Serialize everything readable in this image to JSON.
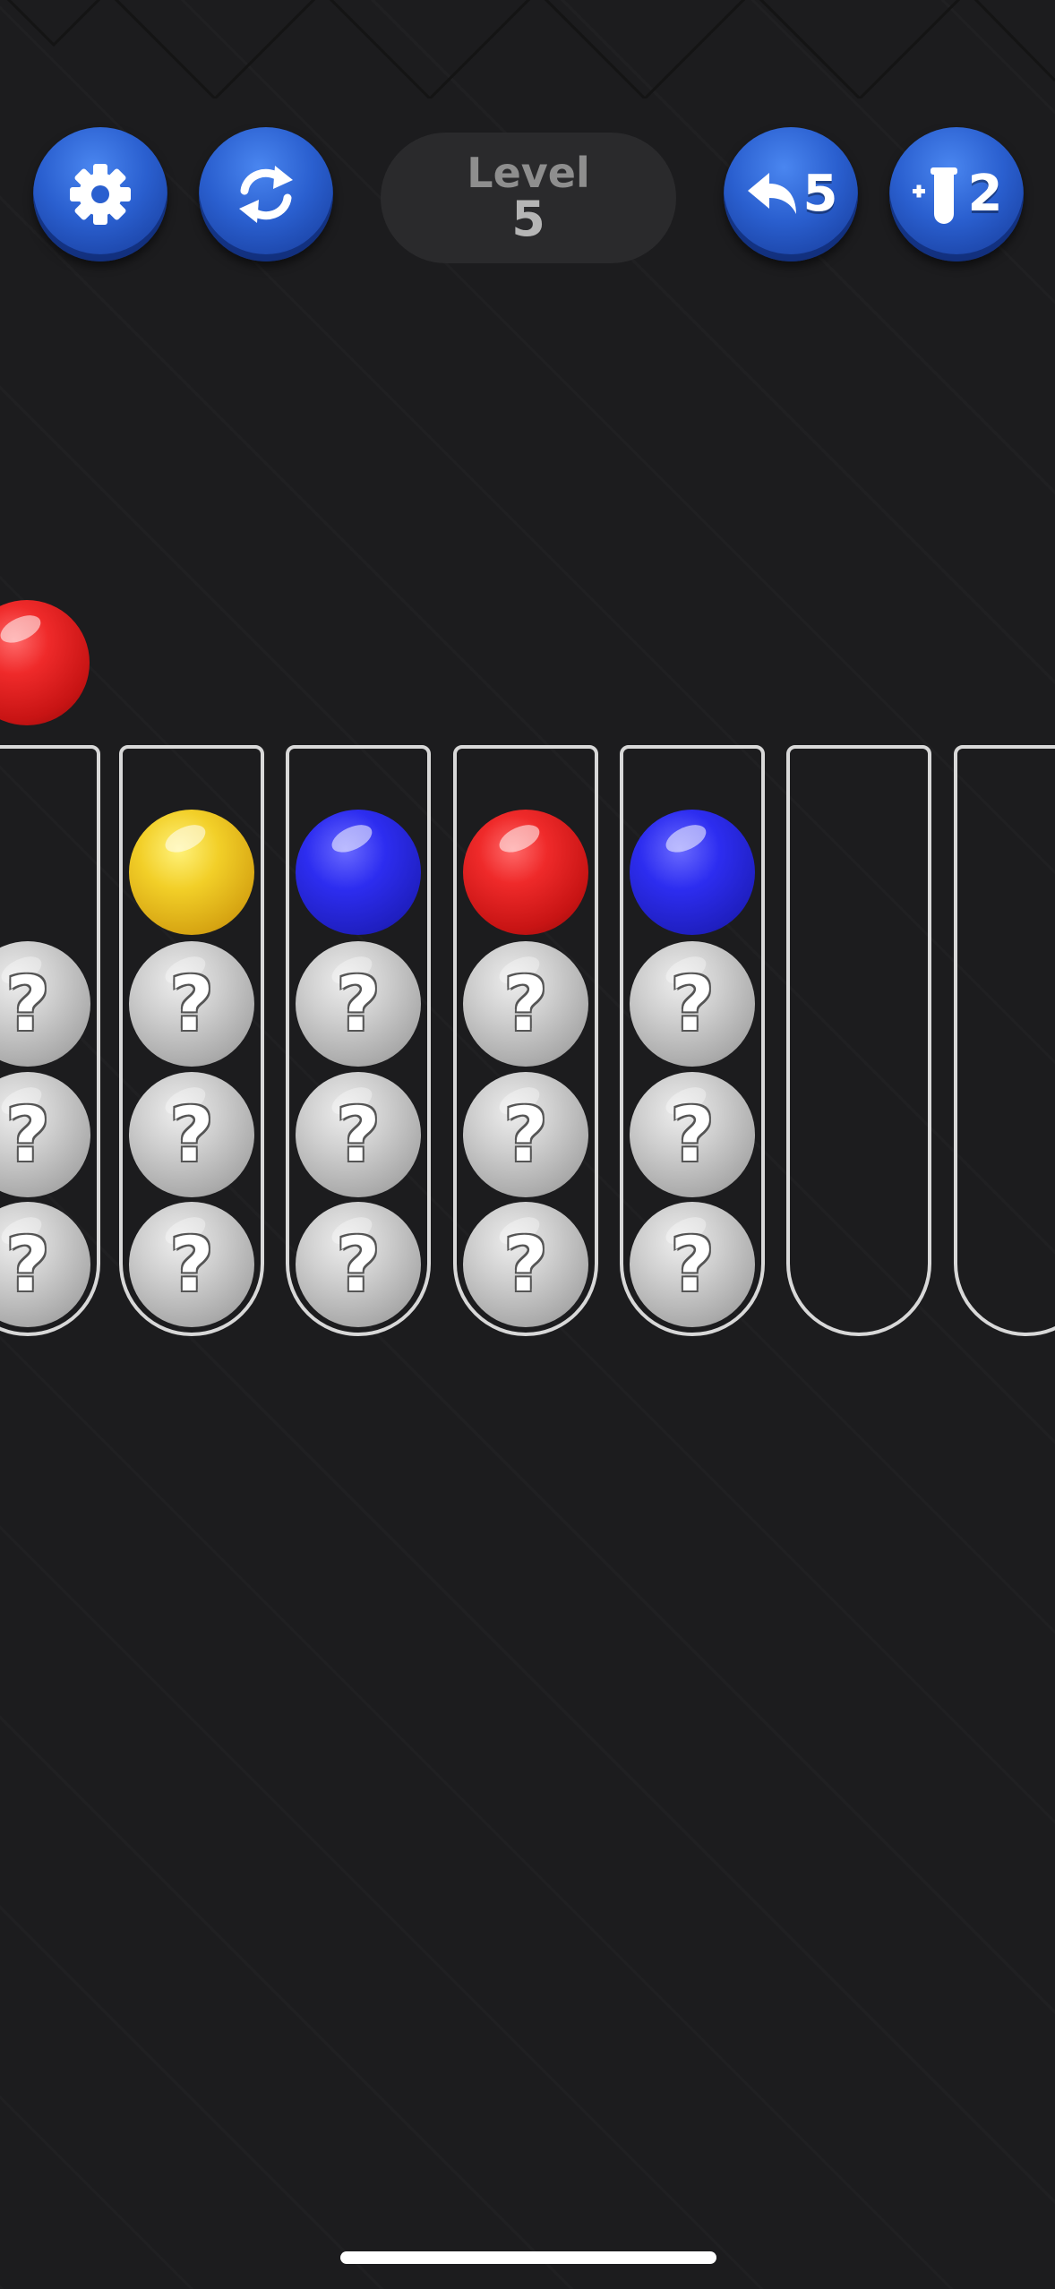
{
  "header": {
    "settings_icon": "gear-icon",
    "restart_icon": "restart-icon",
    "level_label": "Level",
    "level_number": "5",
    "undo_icon": "undo-arrow-icon",
    "undo_count": "5",
    "add_tube_icon": "add-tube-icon",
    "add_tube_count": "2"
  },
  "colors": {
    "background": "#1c1c1e",
    "button_blue": "#2a5fcf",
    "tube_outline": "#d8d8d8",
    "red": "#e02020",
    "yellow": "#f2cf28",
    "blue": "#2d2df0",
    "hidden": "#bdbdbd"
  },
  "held_ball": {
    "color": "red"
  },
  "tubes": [
    {
      "balls": [
        "hidden",
        "hidden",
        "hidden"
      ]
    },
    {
      "balls": [
        "yellow",
        "hidden",
        "hidden",
        "hidden"
      ]
    },
    {
      "balls": [
        "blue",
        "hidden",
        "hidden",
        "hidden"
      ]
    },
    {
      "balls": [
        "red",
        "hidden",
        "hidden",
        "hidden"
      ]
    },
    {
      "balls": [
        "blue",
        "hidden",
        "hidden",
        "hidden"
      ]
    },
    {
      "balls": []
    },
    {
      "balls": []
    }
  ],
  "hidden_ball_symbol": "?"
}
